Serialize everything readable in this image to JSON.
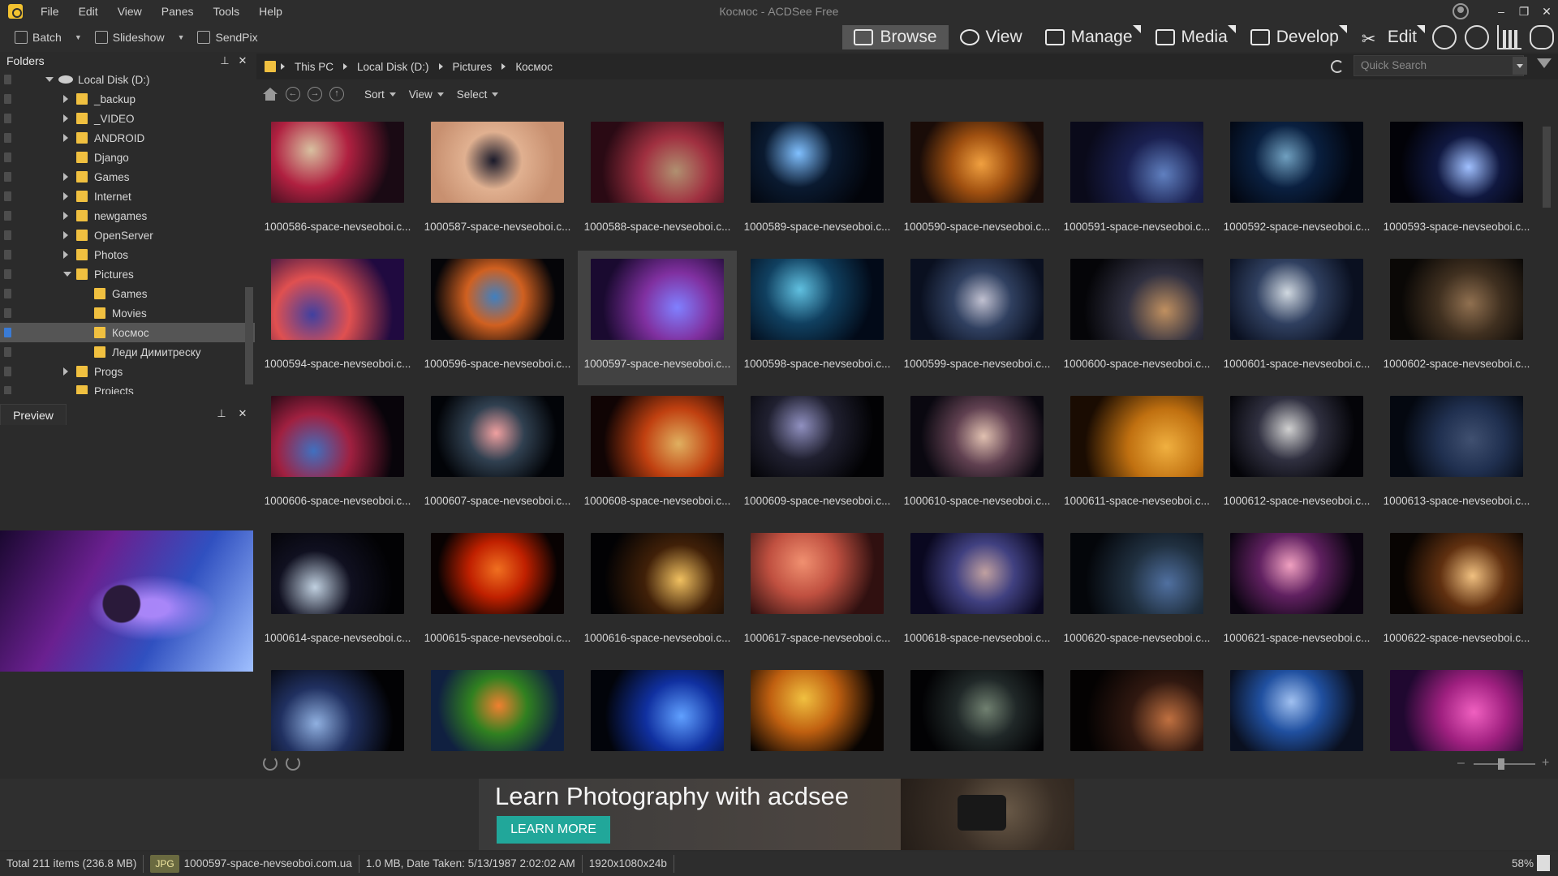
{
  "window": {
    "title": "Космос - ACDSee Free",
    "menu": [
      "File",
      "Edit",
      "View",
      "Panes",
      "Tools",
      "Help"
    ]
  },
  "toolbar": {
    "batch": "Batch",
    "slideshow": "Slideshow",
    "sendpix": "SendPix",
    "modes": [
      "Browse",
      "View",
      "Manage",
      "Media",
      "Develop",
      "Edit"
    ]
  },
  "folders": {
    "title": "Folders",
    "items": [
      {
        "label": "Local Disk (D:)",
        "level": 0,
        "expand": "open",
        "type": "disk"
      },
      {
        "label": "_backup",
        "level": 1,
        "expand": "closed"
      },
      {
        "label": "_VIDEO",
        "level": 1,
        "expand": "closed"
      },
      {
        "label": "ANDROID",
        "level": 1,
        "expand": "closed"
      },
      {
        "label": "Django",
        "level": 1,
        "expand": ""
      },
      {
        "label": "Games",
        "level": 1,
        "expand": "closed"
      },
      {
        "label": "Internet",
        "level": 1,
        "expand": "closed"
      },
      {
        "label": "newgames",
        "level": 1,
        "expand": "closed"
      },
      {
        "label": "OpenServer",
        "level": 1,
        "expand": "closed"
      },
      {
        "label": "Photos",
        "level": 1,
        "expand": "closed"
      },
      {
        "label": "Pictures",
        "level": 1,
        "expand": "open"
      },
      {
        "label": "Games",
        "level": 2,
        "expand": ""
      },
      {
        "label": "Movies",
        "level": 2,
        "expand": ""
      },
      {
        "label": "Космос",
        "level": 2,
        "expand": "",
        "selected": true
      },
      {
        "label": "Леди Димитреску",
        "level": 2,
        "expand": ""
      },
      {
        "label": "Progs",
        "level": 1,
        "expand": "closed"
      },
      {
        "label": "Projects",
        "level": 1,
        "expand": ""
      }
    ]
  },
  "preview": {
    "title": "Preview"
  },
  "path": {
    "crumbs": [
      "This PC",
      "Local Disk (D:)",
      "Pictures",
      "Космос"
    ],
    "search_placeholder": "Quick Search"
  },
  "nav": {
    "sort": "Sort",
    "view": "View",
    "select": "Select"
  },
  "grid": {
    "items": [
      {
        "name": "1000586-space-nevseoboi.c...",
        "colors": [
          "#1a0a14",
          "#b02040",
          "#d8c0a0"
        ]
      },
      {
        "name": "1000587-space-nevseoboi.c...",
        "colors": [
          "#c89070",
          "#e0b090",
          "#1a1a2a"
        ]
      },
      {
        "name": "1000588-space-nevseoboi.c...",
        "colors": [
          "#2a0a14",
          "#a03040",
          "#b09070"
        ]
      },
      {
        "name": "1000589-space-nevseoboi.c...",
        "colors": [
          "#02040a",
          "#0a1a30",
          "#80c0ff"
        ]
      },
      {
        "name": "1000590-space-nevseoboi.c...",
        "colors": [
          "#1a0c08",
          "#a05010",
          "#f0a040"
        ]
      },
      {
        "name": "1000591-space-nevseoboi.c...",
        "colors": [
          "#0a0a1a",
          "#1a2050",
          "#6080c0"
        ]
      },
      {
        "name": "1000592-space-nevseoboi.c...",
        "colors": [
          "#020610",
          "#0a2040",
          "#70a0c0"
        ]
      },
      {
        "name": "1000593-space-nevseoboi.c...",
        "colors": [
          "#020208",
          "#101840",
          "#a0c0ff"
        ]
      },
      {
        "name": "1000594-space-nevseoboi.c...",
        "colors": [
          "#200a40",
          "#e05050",
          "#4040a0"
        ]
      },
      {
        "name": "1000596-space-nevseoboi.c...",
        "colors": [
          "#050508",
          "#d06020",
          "#4080c0"
        ]
      },
      {
        "name": "1000597-space-nevseoboi.c...",
        "colors": [
          "#1a0a30",
          "#8030a0",
          "#8080ff"
        ],
        "selected": true
      },
      {
        "name": "1000598-space-nevseoboi.c...",
        "colors": [
          "#020a18",
          "#104060",
          "#60c0e0"
        ]
      },
      {
        "name": "1000599-space-nevseoboi.c...",
        "colors": [
          "#0a1020",
          "#304060",
          "#c0c0d0"
        ]
      },
      {
        "name": "1000600-space-nevseoboi.c...",
        "colors": [
          "#050508",
          "#303040",
          "#c09060"
        ]
      },
      {
        "name": "1000601-space-nevseoboi.c...",
        "colors": [
          "#0a1020",
          "#304060",
          "#d0d8e0"
        ]
      },
      {
        "name": "1000602-space-nevseoboi.c...",
        "colors": [
          "#0a0806",
          "#403020",
          "#907050"
        ]
      },
      {
        "name": "1000606-space-nevseoboi.c...",
        "colors": [
          "#08040a",
          "#a02040",
          "#4070c0"
        ]
      },
      {
        "name": "1000607-space-nevseoboi.c...",
        "colors": [
          "#020408",
          "#304050",
          "#f0a0a0"
        ]
      },
      {
        "name": "1000608-space-nevseoboi.c...",
        "colors": [
          "#100404",
          "#c04010",
          "#e0b060"
        ]
      },
      {
        "name": "1000609-space-nevseoboi.c...",
        "colors": [
          "#020204",
          "#202030",
          "#9090c0"
        ]
      },
      {
        "name": "1000610-space-nevseoboi.c...",
        "colors": [
          "#0a0810",
          "#604050",
          "#e0c0b0"
        ]
      },
      {
        "name": "1000611-space-nevseoboi.c...",
        "colors": [
          "#1a0c02",
          "#c07010",
          "#f0b040"
        ]
      },
      {
        "name": "1000612-space-nevseoboi.c...",
        "colors": [
          "#040408",
          "#303040",
          "#d0d0d0"
        ]
      },
      {
        "name": "1000613-space-nevseoboi.c...",
        "colors": [
          "#040810",
          "#203050",
          "#405070"
        ]
      },
      {
        "name": "1000614-space-nevseoboi.c...",
        "colors": [
          "#020204",
          "#101020",
          "#c0d0e0"
        ]
      },
      {
        "name": "1000615-space-nevseoboi.c...",
        "colors": [
          "#080202",
          "#c02000",
          "#f07020"
        ]
      },
      {
        "name": "1000616-space-nevseoboi.c...",
        "colors": [
          "#020204",
          "#402008",
          "#f0c060"
        ]
      },
      {
        "name": "1000617-space-nevseoboi.c...",
        "colors": [
          "#301010",
          "#c05040",
          "#f09070"
        ]
      },
      {
        "name": "1000618-space-nevseoboi.c...",
        "colors": [
          "#0a0820",
          "#404080",
          "#c0a0a0"
        ]
      },
      {
        "name": "1000620-space-nevseoboi.c...",
        "colors": [
          "#04060a",
          "#203040",
          "#5070a0"
        ]
      },
      {
        "name": "1000621-space-nevseoboi.c...",
        "colors": [
          "#0a0410",
          "#602060",
          "#f0a0c0"
        ]
      },
      {
        "name": "1000622-space-nevseoboi.c...",
        "colors": [
          "#080402",
          "#603010",
          "#f0c080"
        ]
      },
      {
        "name": "",
        "colors": [
          "#020204",
          "#203060",
          "#90b0e0"
        ]
      },
      {
        "name": "",
        "colors": [
          "#102040",
          "#308020",
          "#f08030"
        ]
      },
      {
        "name": "",
        "colors": [
          "#02040a",
          "#1030a0",
          "#60a0ff"
        ]
      },
      {
        "name": "",
        "colors": [
          "#080402",
          "#c06010",
          "#f0c040"
        ]
      },
      {
        "name": "",
        "colors": [
          "#020204",
          "#202828",
          "#708070"
        ]
      },
      {
        "name": "",
        "colors": [
          "#040202",
          "#301810",
          "#c07040"
        ]
      },
      {
        "name": "",
        "colors": [
          "#0a1020",
          "#2050a0",
          "#a0c0f0"
        ]
      },
      {
        "name": "",
        "colors": [
          "#200830",
          "#a02080",
          "#f060c0"
        ]
      }
    ]
  },
  "ad": {
    "title": "Learn Photography with acdsee",
    "button": "LEARN MORE"
  },
  "status": {
    "total": "Total 211 items  (236.8 MB)",
    "type": "JPG",
    "file": "1000597-space-nevseoboi.com.ua",
    "info": "1.0 MB, Date Taken: 5/13/1987 2:02:02 AM",
    "dims": "1920x1080x24b",
    "zoom": "58%"
  }
}
